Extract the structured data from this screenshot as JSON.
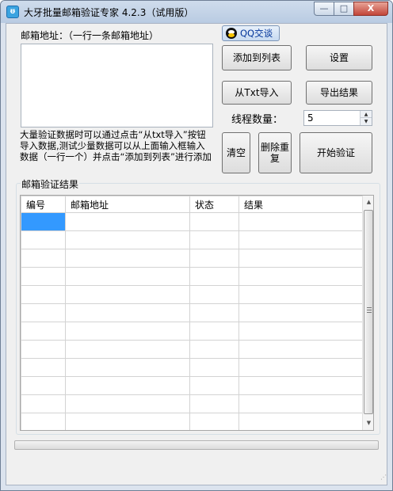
{
  "window": {
    "title": "大牙批量邮箱验证专家 4.2.3（试用版）",
    "app_icon": "tooth-icon",
    "controls": {
      "minimize": "—",
      "maximize": "□",
      "close": "X"
    }
  },
  "input": {
    "label": "邮箱地址：（一行一条邮箱地址）",
    "value": ""
  },
  "qq_button": {
    "label": "QQ交谈",
    "icon": "qq-penguin-icon"
  },
  "buttons": {
    "add_to_list": "添加到列表",
    "settings": "设置",
    "import_txt": "从Txt导入",
    "export_results": "导出结果",
    "clear": "清空",
    "delete_duplicates": "删除重复",
    "start_verify": "开始验证"
  },
  "thread": {
    "label": "线程数量：",
    "value": "5"
  },
  "hint_text": "大量验证数据时可以通过点击“从txt导入”按钮导入数据,测试少量数据可以从上面输入框输入数据（一行一个）并点击“添加到列表”进行添加",
  "results": {
    "group_label": "邮箱验证结果",
    "columns": [
      "编号",
      "邮箱地址",
      "状态",
      "结果"
    ],
    "rows": [
      [
        "",
        "",
        "",
        ""
      ],
      [
        "",
        "",
        "",
        ""
      ],
      [
        "",
        "",
        "",
        ""
      ],
      [
        "",
        "",
        "",
        ""
      ],
      [
        "",
        "",
        "",
        ""
      ],
      [
        "",
        "",
        "",
        ""
      ],
      [
        "",
        "",
        "",
        ""
      ],
      [
        "",
        "",
        "",
        ""
      ],
      [
        "",
        "",
        "",
        ""
      ],
      [
        "",
        "",
        "",
        ""
      ],
      [
        "",
        "",
        "",
        ""
      ],
      [
        "",
        "",
        "",
        ""
      ]
    ],
    "selected_row": 0
  },
  "progress": {
    "value": 0
  },
  "colors": {
    "selection": "#3399ff",
    "window_frame": "#dbe3ee",
    "client_bg": "#f0f0f0"
  }
}
